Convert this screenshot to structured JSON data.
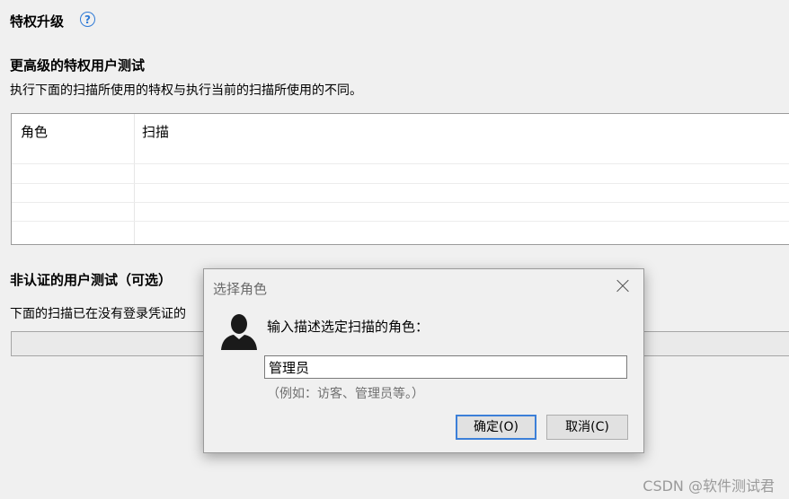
{
  "page": {
    "title": "特权升级",
    "help_icon_glyph": "?",
    "higher_test": {
      "heading": "更高级的特权用户测试",
      "description": "执行下面的扫描所使用的特权与执行当前的扫描所使用的不同。"
    },
    "table": {
      "columns": [
        "角色",
        "扫描"
      ]
    },
    "unauth_test": {
      "heading": "非认证的用户测试（可选）",
      "description": "下面的扫描已在没有登录凭证的"
    }
  },
  "dialog": {
    "title": "选择角色",
    "prompt": "输入描述选定扫描的角色：",
    "role_value": "管理员",
    "hint": "（例如：访客、管理员等。）",
    "ok_label": "确定(O)",
    "cancel_label": "取消(C)",
    "icon": "user-silhouette-icon"
  },
  "watermark": "CSDN @软件测试君"
}
